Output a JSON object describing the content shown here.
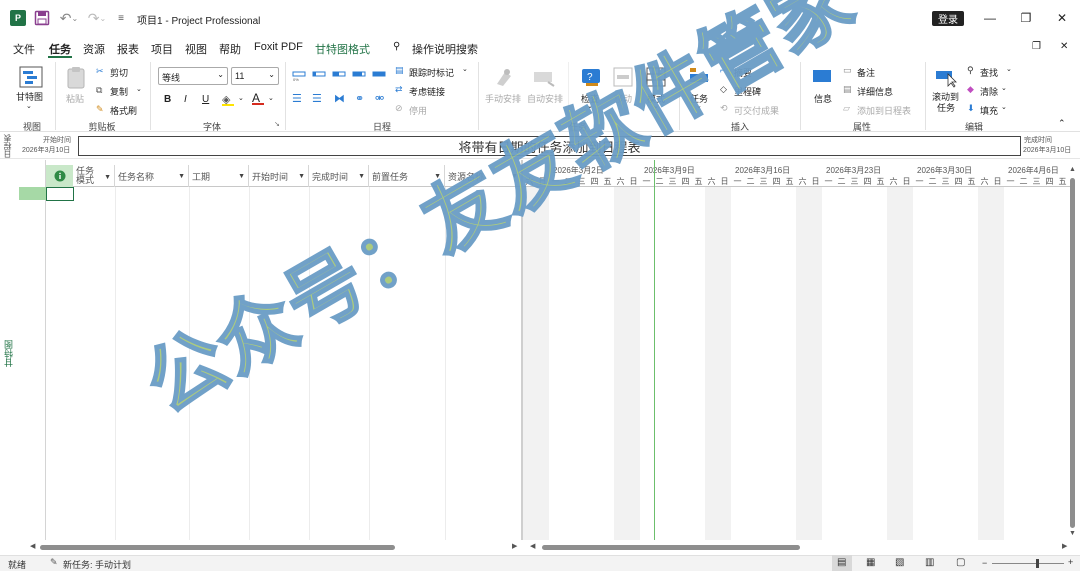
{
  "titlebar": {
    "title": "项目1 - Project Professional",
    "login_label": "登录",
    "minimize": "—",
    "restore": "❐",
    "close": "✕"
  },
  "tabs": {
    "file": "文件",
    "task": "任务",
    "resource": "资源",
    "report": "报表",
    "project": "项目",
    "view": "视图",
    "help": "帮助",
    "foxit": "Foxit PDF",
    "gantt_format": "甘特图格式",
    "search": "操作说明搜索"
  },
  "ribbon": {
    "view_group": {
      "label": "视图",
      "gantt_btn": "甘特图"
    },
    "clipboard_group": {
      "label": "剪贴板",
      "paste": "粘贴",
      "cut": "剪切",
      "copy": "复制",
      "format_painter": "格式刷"
    },
    "font_group": {
      "label": "字体",
      "font_name": "等线",
      "font_size": "11",
      "bold": "B",
      "italic": "I",
      "underline": "U"
    },
    "schedule_group": {
      "label": "日程",
      "track": "跟踪时标记",
      "respect_links": "考虑链接",
      "inactivate": "停用"
    },
    "tasks_group": {
      "label": "任务",
      "manual": "手动安排",
      "auto": "自动安排",
      "inspect": "检查",
      "move": "移动",
      "mode": "模式"
    },
    "insert_group": {
      "label": "插入",
      "task": "任务",
      "summary": "摘要",
      "milestone": "里程碑",
      "deliverable": "可交付成果"
    },
    "properties_group": {
      "label": "属性",
      "info": "信息",
      "notes": "备注",
      "details": "详细信息",
      "add_timeline": "添加到日程表"
    },
    "editing_group": {
      "label": "编辑",
      "scroll_to_task": "滚动到",
      "scroll_to_task2": "任务",
      "find": "查找",
      "clear": "清除",
      "fill": "填充"
    }
  },
  "timeline": {
    "side_label": "日程表",
    "start_label": "开始时间",
    "start_date": "2026年3月10日",
    "placeholder": "将带有日期的任务添加到日程表",
    "end_label": "完成时间",
    "end_date": "2026年3月10日"
  },
  "sheet": {
    "side_label": "甘特图",
    "columns": [
      "任务模式",
      "任务名称",
      "工期",
      "开始时间",
      "完成时间",
      "前置任务",
      "资源名称"
    ]
  },
  "gantt": {
    "week_dates": [
      "2026年3月2日",
      "2026年3月9日",
      "2026年3月16日",
      "2026年3月23日",
      "2026年3月30日",
      "2026年4月6日"
    ],
    "days": [
      "六",
      "日",
      "一",
      "二",
      "三",
      "四",
      "五",
      "六",
      "日",
      "一",
      "二",
      "三",
      "四",
      "五",
      "六",
      "日",
      "一",
      "二",
      "三",
      "四",
      "五",
      "六",
      "日",
      "一",
      "二",
      "三",
      "四",
      "五",
      "六",
      "日",
      "一",
      "二",
      "三",
      "四",
      "五",
      "六",
      "日",
      "一",
      "二",
      "三",
      "四",
      "五"
    ]
  },
  "statusbar": {
    "ready": "就绪",
    "new_tasks": "新任务: 手动计划"
  },
  "watermark": "公众号：友友软件管家",
  "colors": {
    "accent": "#217346",
    "watermark_fill": "#a8c978",
    "watermark_stroke": "#6a9cc6"
  }
}
